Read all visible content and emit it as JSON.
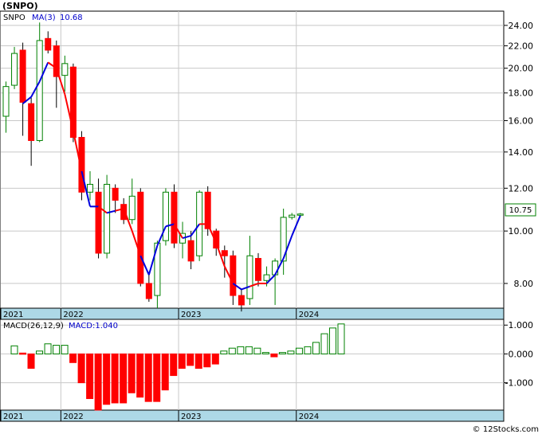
{
  "title": "(SNPO)",
  "legend": {
    "symbol": "SNPO",
    "ma_label": "MA(3)",
    "ma_value": "10.68"
  },
  "price_box": "10.75",
  "macd_legend": {
    "label": "MACD(26,12,9)",
    "value_label": "MACD:1.040"
  },
  "watermark": "© 12Stocks.com",
  "colors": {
    "up": "#008000",
    "down": "#ff0000",
    "ma_up": "#0000dd",
    "ma_down": "#ff0000",
    "axis_band": "#add8e6",
    "grid": "#c8c8c8"
  },
  "chart_data": [
    {
      "type": "candlestick",
      "scale": "log",
      "ylim": [
        7.2,
        25.5
      ],
      "yticks": [
        "24.00",
        "22.00",
        "20.00",
        "18.00",
        "16.00",
        "14.00",
        "12.00",
        "10.00",
        "8.00"
      ],
      "year_labels": [
        "2021",
        "2022",
        "2023",
        "2024"
      ],
      "grid": true,
      "candles": [
        {
          "o": 16.3,
          "h": 18.9,
          "l": 15.2,
          "c": 18.5
        },
        {
          "o": 18.6,
          "h": 21.9,
          "l": 18.3,
          "c": 21.3
        },
        {
          "o": 21.6,
          "h": 22.3,
          "l": 15.0,
          "c": 17.3
        },
        {
          "o": 17.2,
          "h": 17.7,
          "l": 13.2,
          "c": 14.7
        },
        {
          "o": 14.7,
          "h": 24.3,
          "l": 14.6,
          "c": 22.5
        },
        {
          "o": 22.7,
          "h": 23.4,
          "l": 21.3,
          "c": 21.6
        },
        {
          "o": 22.0,
          "h": 22.5,
          "l": 16.9,
          "c": 19.3
        },
        {
          "o": 19.4,
          "h": 21.1,
          "l": 18.1,
          "c": 20.4
        },
        {
          "o": 20.1,
          "h": 20.4,
          "l": 14.6,
          "c": 14.9
        },
        {
          "o": 14.9,
          "h": 15.3,
          "l": 11.4,
          "c": 11.8
        },
        {
          "o": 11.8,
          "h": 12.9,
          "l": 11.4,
          "c": 12.2
        },
        {
          "o": 11.8,
          "h": 12.5,
          "l": 8.9,
          "c": 9.1
        },
        {
          "o": 9.1,
          "h": 12.7,
          "l": 8.9,
          "c": 12.2
        },
        {
          "o": 12.0,
          "h": 12.2,
          "l": 10.8,
          "c": 11.4
        },
        {
          "o": 11.2,
          "h": 11.5,
          "l": 10.3,
          "c": 10.5
        },
        {
          "o": 10.5,
          "h": 12.5,
          "l": 10.3,
          "c": 11.6
        },
        {
          "o": 11.8,
          "h": 12.0,
          "l": 7.9,
          "c": 8.0
        },
        {
          "o": 8.0,
          "h": 8.4,
          "l": 7.4,
          "c": 7.5
        },
        {
          "o": 7.6,
          "h": 9.6,
          "l": 7.2,
          "c": 9.5
        },
        {
          "o": 9.6,
          "h": 12.0,
          "l": 9.4,
          "c": 11.8
        },
        {
          "o": 11.8,
          "h": 12.2,
          "l": 9.3,
          "c": 9.5
        },
        {
          "o": 9.5,
          "h": 10.4,
          "l": 8.9,
          "c": 9.9
        },
        {
          "o": 9.6,
          "h": 10.0,
          "l": 8.5,
          "c": 8.8
        },
        {
          "o": 9.0,
          "h": 11.9,
          "l": 8.8,
          "c": 11.8
        },
        {
          "o": 11.8,
          "h": 12.1,
          "l": 9.8,
          "c": 10.1
        },
        {
          "o": 10.0,
          "h": 10.1,
          "l": 9.0,
          "c": 9.3
        },
        {
          "o": 9.2,
          "h": 9.4,
          "l": 8.2,
          "c": 9.0
        },
        {
          "o": 9.0,
          "h": 9.2,
          "l": 7.3,
          "c": 7.6
        },
        {
          "o": 7.6,
          "h": 7.8,
          "l": 7.1,
          "c": 7.3
        },
        {
          "o": 7.5,
          "h": 9.8,
          "l": 7.3,
          "c": 9.0
        },
        {
          "o": 8.9,
          "h": 9.1,
          "l": 7.9,
          "c": 8.1
        },
        {
          "o": 8.1,
          "h": 8.6,
          "l": 7.9,
          "c": 8.3
        },
        {
          "o": 8.3,
          "h": 8.9,
          "l": 7.3,
          "c": 8.8
        },
        {
          "o": 8.8,
          "h": 11.0,
          "l": 8.3,
          "c": 10.6
        },
        {
          "o": 10.6,
          "h": 10.8,
          "l": 10.5,
          "c": 10.7
        },
        {
          "o": 10.7,
          "h": 10.8,
          "l": 10.6,
          "c": 10.75
        }
      ],
      "ma": [
        {
          "v": 17.2,
          "d": "up"
        },
        {
          "v": 17.7,
          "d": "up"
        },
        {
          "v": 18.9,
          "d": "up"
        },
        {
          "v": 20.5,
          "d": "up"
        },
        {
          "v": 20.0,
          "d": "down"
        },
        {
          "v": 17.9,
          "d": "down"
        },
        {
          "v": 15.3,
          "d": "down"
        },
        {
          "v": 12.9,
          "d": "down"
        },
        {
          "v": 11.1,
          "d": "up"
        },
        {
          "v": 11.1,
          "d": "up"
        },
        {
          "v": 10.8,
          "d": "down"
        },
        {
          "v": 10.9,
          "d": "up"
        },
        {
          "v": 11.0,
          "d": "down"
        },
        {
          "v": 10.0,
          "d": "down"
        },
        {
          "v": 9.0,
          "d": "down"
        },
        {
          "v": 8.3,
          "d": "up"
        },
        {
          "v": 9.4,
          "d": "up"
        },
        {
          "v": 10.2,
          "d": "up"
        },
        {
          "v": 10.3,
          "d": "up"
        },
        {
          "v": 9.7,
          "d": "down"
        },
        {
          "v": 9.8,
          "d": "up"
        },
        {
          "v": 10.3,
          "d": "up"
        },
        {
          "v": 10.3,
          "d": "down"
        },
        {
          "v": 9.5,
          "d": "down"
        },
        {
          "v": 8.6,
          "d": "down"
        },
        {
          "v": 8.0,
          "d": "down"
        },
        {
          "v": 7.8,
          "d": "up"
        },
        {
          "v": 7.9,
          "d": "up"
        },
        {
          "v": 8.0,
          "d": "down"
        },
        {
          "v": 8.0,
          "d": "down"
        },
        {
          "v": 8.3,
          "d": "up"
        },
        {
          "v": 8.9,
          "d": "up"
        },
        {
          "v": 9.8,
          "d": "up"
        },
        {
          "v": 10.68,
          "d": "up"
        }
      ]
    },
    {
      "type": "bar",
      "name": "MACD",
      "ylim": [
        -1.95,
        1.2
      ],
      "yticks": [
        "1.000",
        "0.000",
        "-1.000"
      ],
      "year_labels": [
        "2021",
        "2022",
        "2023",
        "2024"
      ],
      "values": [
        0.28,
        0.03,
        -0.5,
        0.1,
        0.35,
        0.3,
        0.3,
        -0.3,
        -1.0,
        -1.55,
        -1.95,
        -1.75,
        -1.7,
        -1.7,
        -1.35,
        -1.5,
        -1.65,
        -1.65,
        -1.25,
        -0.75,
        -0.5,
        -0.4,
        -0.5,
        -0.45,
        -0.35,
        0.1,
        0.2,
        0.25,
        0.25,
        0.2,
        0.05,
        -0.1,
        0.05,
        0.1,
        0.2,
        0.25,
        0.4,
        0.7,
        0.9,
        1.04
      ],
      "colors": [
        "up",
        "down",
        "down",
        "up",
        "up",
        "up",
        "up",
        "down",
        "down",
        "down",
        "down",
        "down",
        "down",
        "down",
        "down",
        "down",
        "down",
        "down",
        "down",
        "down",
        "down",
        "down",
        "down",
        "down",
        "down",
        "up",
        "up",
        "up",
        "up",
        "up",
        "up",
        "down",
        "up",
        "up",
        "up",
        "up",
        "up",
        "up",
        "up",
        "up"
      ]
    }
  ]
}
